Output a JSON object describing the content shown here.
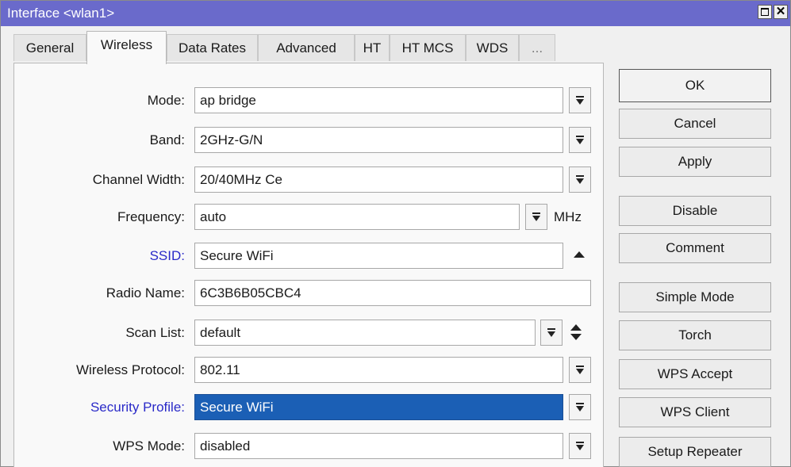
{
  "window": {
    "title": "Interface <wlan1>"
  },
  "tabs": [
    "General",
    "Wireless",
    "Data Rates",
    "Advanced",
    "HT",
    "HT MCS",
    "WDS",
    "..."
  ],
  "form": {
    "mode": {
      "label": "Mode:",
      "value": "ap bridge"
    },
    "band": {
      "label": "Band:",
      "value": "2GHz-G/N"
    },
    "channel_width": {
      "label": "Channel Width:",
      "value": "20/40MHz Ce"
    },
    "frequency": {
      "label": "Frequency:",
      "value": "auto",
      "unit": "MHz"
    },
    "ssid": {
      "label": "SSID:",
      "value": "Secure WiFi"
    },
    "radio_name": {
      "label": "Radio Name:",
      "value": "6C3B6B05CBC4"
    },
    "scan_list": {
      "label": "Scan List:",
      "value": "default"
    },
    "wireless_protocol": {
      "label": "Wireless Protocol:",
      "value": "802.11"
    },
    "security_profile": {
      "label": "Security Profile:",
      "value": "Secure WiFi"
    },
    "wps_mode": {
      "label": "WPS Mode:",
      "value": "disabled"
    }
  },
  "buttons": {
    "ok": "OK",
    "cancel": "Cancel",
    "apply": "Apply",
    "disable": "Disable",
    "comment": "Comment",
    "simple_mode": "Simple Mode",
    "torch": "Torch",
    "wps_accept": "WPS Accept",
    "wps_client": "WPS Client",
    "setup_repeater": "Setup Repeater"
  },
  "colors": {
    "titlebar": "#6a6acb",
    "link_label": "#2a2ac8",
    "selection": "#1b5fb5"
  },
  "icons": {
    "dropdown": "dropdown-arrow-icon",
    "collapse": "collapse-up-icon",
    "updown": "up-down-icon"
  }
}
